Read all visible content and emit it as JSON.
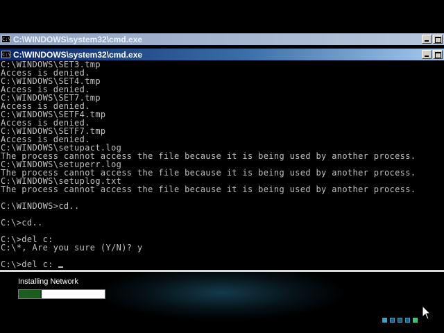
{
  "windows": [
    {
      "title": "C:\\WINDOWS\\system32\\cmd.exe",
      "icon": "C:\\",
      "state": "inactive"
    },
    {
      "title": "C:\\WINDOWS\\system32\\cmd.exe",
      "icon": "C:\\",
      "state": "active"
    }
  ],
  "console": {
    "lines": [
      "C:\\WINDOWS\\SET3.tmp",
      "Access is denied.",
      "C:\\WINDOWS\\SET4.tmp",
      "Access is denied.",
      "C:\\WINDOWS\\SET7.tmp",
      "Access is denied.",
      "C:\\WINDOWS\\SETF4.tmp",
      "Access is denied.",
      "C:\\WINDOWS\\SETF7.tmp",
      "Access is denied.",
      "C:\\WINDOWS\\setupact.log",
      "The process cannot access the file because it is being used by another process.",
      "C:\\WINDOWS\\setuperr.log",
      "The process cannot access the file because it is being used by another process.",
      "C:\\WINDOWS\\setuplog.txt",
      "The process cannot access the file because it is being used by another process.",
      "",
      "C:\\WINDOWS>cd..",
      "",
      "C:\\>cd..",
      "",
      "C:\\>del c:",
      "C:\\*, Are you sure (Y/N)? y",
      ""
    ],
    "prompt_line": "C:\\>del c: "
  },
  "setup": {
    "status_text": "Installing Network",
    "progress_fraction": 0.27,
    "step_dots": 5
  },
  "colors": {
    "console_text": "#c0c0c0",
    "console_bg": "#000000",
    "progress_fill": "#1b5e20",
    "active_title": "#0a246a"
  }
}
